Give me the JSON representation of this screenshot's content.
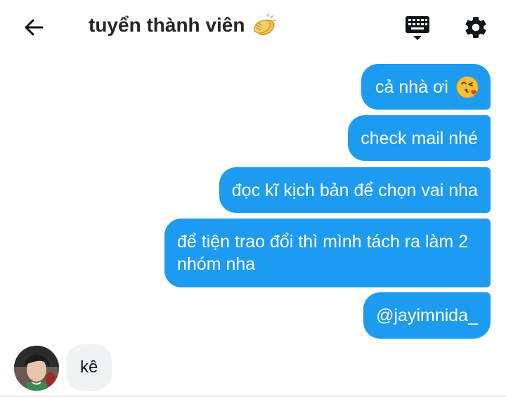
{
  "header": {
    "title": "tuyển thành viên",
    "title_emoji": "clapping-hands",
    "back_icon": "arrow-left-icon",
    "keyboard_icon": "keyboard-icon",
    "settings_icon": "gear-icon"
  },
  "messages": {
    "outgoing": [
      {
        "text": "cả nhà ơi",
        "emoji": "face-blowing-kiss"
      },
      {
        "text": "check mail nhé"
      },
      {
        "text": "đọc kĩ kịch bản để chọn vai nha"
      },
      {
        "text": "để tiện trao đổi thì mình tách ra làm 2 nhóm nha"
      },
      {
        "text": "@jayimnida_"
      }
    ],
    "incoming": [
      {
        "text": "kê"
      }
    ]
  },
  "colors": {
    "outgoing_bubble": "#1d9bf0",
    "incoming_bubble": "#eff3f4",
    "title_text": "#262626"
  }
}
